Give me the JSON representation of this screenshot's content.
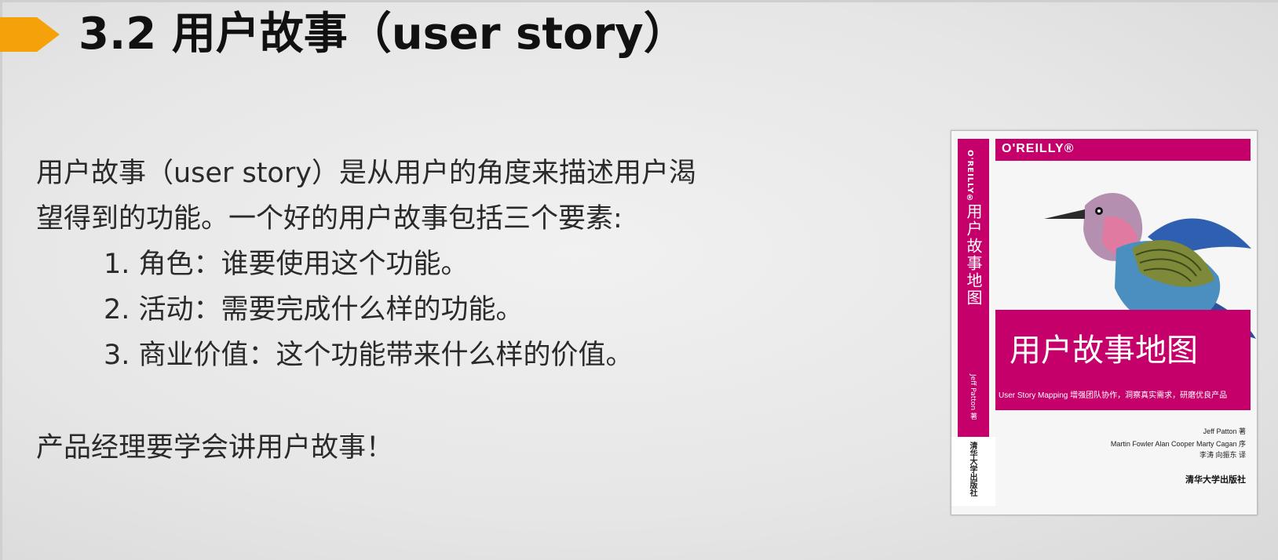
{
  "title": "3.2 用户故事（user story）",
  "body": {
    "intro_line1": "用户故事（user story）是从用户的角度来描述用户渴",
    "intro_line2": "望得到的功能。一个好的用户故事包括三个要素:",
    "list": [
      "1. 角色：谁要使用这个功能。",
      "2. 活动：需要完成什么样的功能。",
      "3. 商业价值：这个功能带来什么样的价值。"
    ],
    "closing": "产品经理要学会讲用户故事！"
  },
  "book": {
    "brand": "O'REILLY®",
    "spine_title": "用户故事地图",
    "spine_author": "Jeff Patton 著",
    "spine_publisher": "清华大学出版社",
    "title": "用户故事地图",
    "subtitle": "User Story Mapping  增强团队协作，洞察真实需求，研磨优良产品",
    "credit_author": "Jeff Patton 著",
    "credit_preface": "Martin Fowler  Alan Cooper  Marty Cagan 序",
    "credit_translator": "李涛  向振东 译",
    "publisher": "清华大学出版社"
  },
  "colors": {
    "accent": "#f5a20a",
    "cover_magenta": "#c5006a"
  }
}
